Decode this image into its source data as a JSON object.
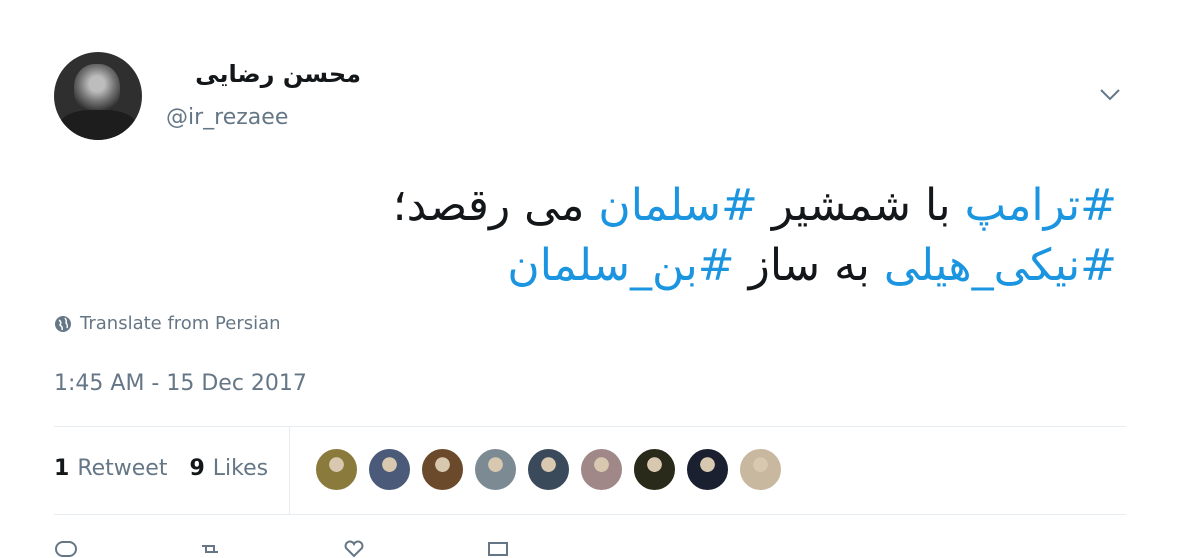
{
  "author": {
    "display_name": "محسن رضایی",
    "handle": "@ir_rezaee",
    "avatar_icon": "person-avatar"
  },
  "menu": {
    "icon": "chevron-down-icon"
  },
  "tweet": {
    "line1": [
      {
        "text": "#ترامپ",
        "hashtag": true
      },
      {
        "text": " با شمشیر ",
        "hashtag": false
      },
      {
        "text": "#سلمان",
        "hashtag": true
      },
      {
        "text": " می رقصد؛",
        "hashtag": false
      }
    ],
    "line2": [
      {
        "text": "#نیکی_هیلی",
        "hashtag": true
      },
      {
        "text": " به ساز  ",
        "hashtag": false
      },
      {
        "text": "#بن_سلمان",
        "hashtag": true
      }
    ]
  },
  "translate": {
    "label": "Translate from Persian",
    "icon": "globe-icon"
  },
  "timestamp": "1:45 AM - 15 Dec 2017",
  "stats": {
    "retweets_count": "1",
    "retweets_label": "Retweet",
    "likes_count": "9",
    "likes_label": "Likes"
  },
  "likers": [
    {
      "color": "#8a7a3c"
    },
    {
      "color": "#4a5a78"
    },
    {
      "color": "#6a4a2a"
    },
    {
      "color": "#7c8a94"
    },
    {
      "color": "#3a4a5a"
    },
    {
      "color": "#a08888"
    },
    {
      "color": "#2a2a1a"
    },
    {
      "color": "#1a2030"
    },
    {
      "color": "#c8b8a0"
    }
  ],
  "colors": {
    "hashtag": "#1b95e0",
    "text": "#14171a",
    "secondary": "#657786"
  }
}
